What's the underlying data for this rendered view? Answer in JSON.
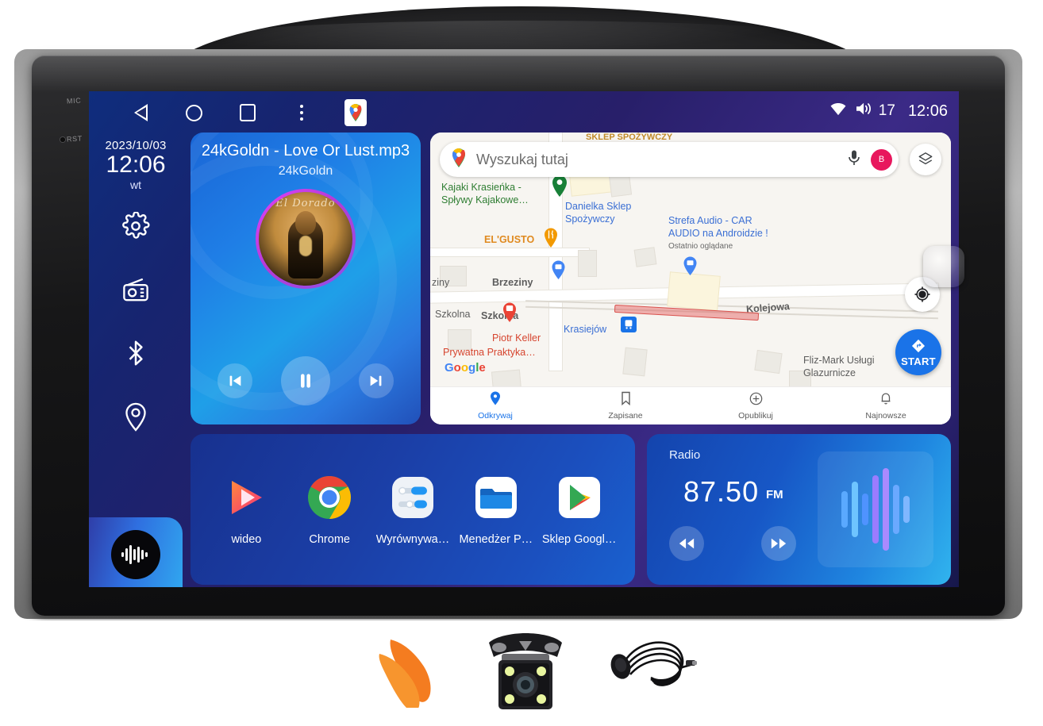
{
  "device": {
    "bezel_labels": {
      "mic": "MIC",
      "rst": "RST"
    },
    "brand_accent": "#1a73e8"
  },
  "statusbar": {
    "nav": [
      {
        "name": "back",
        "icon": "back-triangle-icon"
      },
      {
        "name": "home",
        "icon": "home-circle-icon"
      },
      {
        "name": "recents",
        "icon": "recents-square-icon"
      },
      {
        "name": "overflow",
        "icon": "more-vertical-icon"
      },
      {
        "name": "maps-shortcut",
        "icon": "google-maps-icon"
      }
    ],
    "wifi_icon": "wifi-icon",
    "volume_icon": "volume-icon",
    "volume_level": "17",
    "clock": "12:06"
  },
  "rail": {
    "date": "2023/10/03",
    "time": "12:06",
    "day_of_week": "wt",
    "items": [
      {
        "icon": "settings-gear-icon",
        "name": "settings"
      },
      {
        "icon": "radio-icon",
        "name": "radio"
      },
      {
        "icon": "bluetooth-icon",
        "name": "bluetooth"
      },
      {
        "icon": "location-pin-icon",
        "name": "navigation"
      }
    ],
    "active_item": {
      "icon": "audio-waveform-icon",
      "name": "music"
    }
  },
  "music": {
    "title": "24kGoldn - Love Or Lust.mp3",
    "artist": "24kGoldn",
    "album_script": "El Dorado",
    "controls": {
      "previous": "skip-previous-icon",
      "play_pause": "pause-icon",
      "next": "skip-next-icon"
    }
  },
  "map": {
    "search_placeholder": "Wyszukaj tutaj",
    "mic_icon": "microphone-icon",
    "avatar_initial": "B",
    "avatar_color": "#e8175d",
    "layers_icon": "layers-icon",
    "locate_icon": "my-location-icon",
    "start_label": "START",
    "attribution": "Google",
    "clipped_top_label": "SKLEP SPOŻYWCZY",
    "labels": [
      {
        "text": "Kajaki Krasieńka -",
        "color": "green"
      },
      {
        "text": "Spływy Kajakowe…",
        "color": "green"
      },
      {
        "text": "Danielka Sklep",
        "color": "blue"
      },
      {
        "text": "Spożywczy",
        "color": "blue"
      },
      {
        "text": "EL'GUSTO",
        "color": "orange"
      },
      {
        "text": "Strefa Audio - CAR",
        "color": "blue"
      },
      {
        "text": "AUDIO na Androidzie !",
        "color": "blue"
      },
      {
        "text": "Ostatnio oglądane",
        "color": "sub"
      },
      {
        "text": "ziny",
        "color": "grey"
      },
      {
        "text": "Brzeziny",
        "color": "grey"
      },
      {
        "text": "Szkolna",
        "color": "grey"
      },
      {
        "text": "Szkolna",
        "color": "grey"
      },
      {
        "text": "Kolejowa",
        "color": "grey"
      },
      {
        "text": "Krasiejów",
        "color": "blue"
      },
      {
        "text": "Piotr Keller",
        "color": "red"
      },
      {
        "text": "Prywatna Praktyka…",
        "color": "red"
      },
      {
        "text": "Fliz-Mark Usługi",
        "color": "grey"
      },
      {
        "text": "Glazurnicze",
        "color": "grey"
      }
    ],
    "bottom_nav": [
      {
        "label": "Odkrywaj",
        "icon": "map-pin-icon",
        "active": true
      },
      {
        "label": "Zapisane",
        "icon": "bookmark-icon",
        "active": false
      },
      {
        "label": "Opublikuj",
        "icon": "plus-circle-icon",
        "active": false
      },
      {
        "label": "Najnowsze",
        "icon": "bell-icon",
        "active": false
      }
    ]
  },
  "dock": {
    "apps": [
      {
        "label": "wideo",
        "icon": "video-play-icon"
      },
      {
        "label": "Chrome",
        "icon": "chrome-icon"
      },
      {
        "label": "Wyrównywa…",
        "icon": "equalizer-icon"
      },
      {
        "label": "Menedżer P…",
        "icon": "file-manager-folder-icon"
      },
      {
        "label": "Sklep Googl…",
        "icon": "google-play-icon"
      }
    ]
  },
  "radio": {
    "title": "Radio",
    "frequency": "87.50",
    "band": "FM",
    "prev_icon": "rewind-icon",
    "next_icon": "fast-forward-icon",
    "visualizer_bars": [
      46,
      70,
      40,
      86,
      104,
      62,
      34
    ]
  },
  "accessories": [
    {
      "name": "pry-tools",
      "label": "Narzędzia montażowe"
    },
    {
      "name": "reverse-camera",
      "label": "Kamera cofania"
    },
    {
      "name": "external-microphone",
      "label": "Mikrofon zewnętrzny"
    }
  ]
}
